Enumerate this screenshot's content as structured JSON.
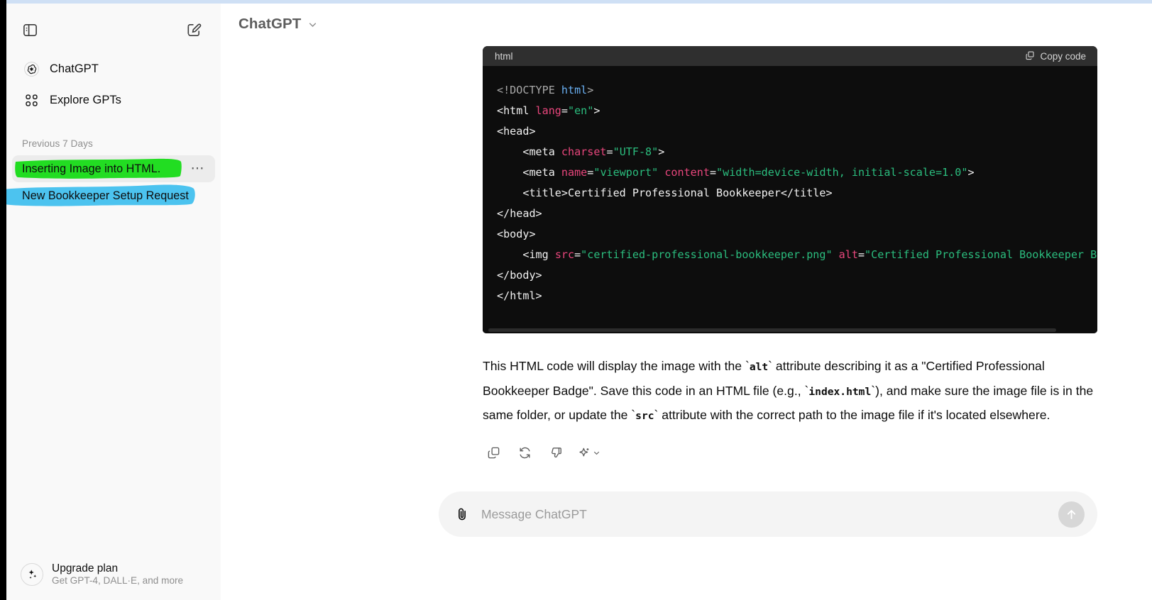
{
  "sidebar": {
    "toggle_icon": "sidebar-panel-icon",
    "new_chat_icon": "compose-pencil-icon",
    "nav": [
      {
        "label": "ChatGPT",
        "icon": "openai-logo-icon"
      },
      {
        "label": "Explore GPTs",
        "icon": "grid-dots-icon"
      }
    ],
    "section_label": "Previous 7 Days",
    "chats": [
      {
        "label": "Inserting Image into HTML.",
        "highlight": "#22dd22",
        "menu_icon": "ellipsis-icon",
        "active": true
      },
      {
        "label": "New Bookkeeper Setup Request",
        "highlight": "#4cc3ef",
        "active": false
      }
    ],
    "upgrade": {
      "icon": "sparkles-icon",
      "title": "Upgrade plan",
      "subtitle": "Get GPT-4, DALL·E, and more"
    }
  },
  "header": {
    "model": "ChatGPT",
    "chevron_icon": "chevron-down-icon"
  },
  "code_block": {
    "language": "html",
    "copy_label": "Copy code",
    "copy_icon": "copy-icon",
    "lines": [
      "<!DOCTYPE html>",
      "<html lang=\"en\">",
      "<head>",
      "    <meta charset=\"UTF-8\">",
      "    <meta name=\"viewport\" content=\"width=device-width, initial-scale=1.0\">",
      "    <title>Certified Professional Bookkeeper</title>",
      "</head>",
      "<body>",
      "    <img src=\"certified-professional-bookkeeper.png\" alt=\"Certified Professional Bookkeeper Badge\">",
      "</body>",
      "</html>"
    ]
  },
  "message": {
    "paragraph_parts": [
      {
        "t": "This HTML code will display the image with the `",
        "code": false
      },
      {
        "t": "alt",
        "code": true
      },
      {
        "t": "` attribute describing it as a \"Certified Professional Bookkeeper Badge\". Save this code in an HTML file (e.g., `",
        "code": false
      },
      {
        "t": "index.html",
        "code": true
      },
      {
        "t": "`), and make sure the image file is in the same folder, or update the `",
        "code": false
      },
      {
        "t": "src",
        "code": true
      },
      {
        "t": "` attribute with the correct path to the image file if it's located elsewhere.",
        "code": false
      }
    ],
    "actions": [
      {
        "name": "copy-message-icon"
      },
      {
        "name": "regenerate-icon"
      },
      {
        "name": "thumbs-down-icon"
      },
      {
        "name": "sparkle-model-switch-icon"
      }
    ]
  },
  "composer": {
    "placeholder": "Message ChatGPT",
    "value": "",
    "attach_icon": "paperclip-icon",
    "send_icon": "arrow-up-icon"
  }
}
